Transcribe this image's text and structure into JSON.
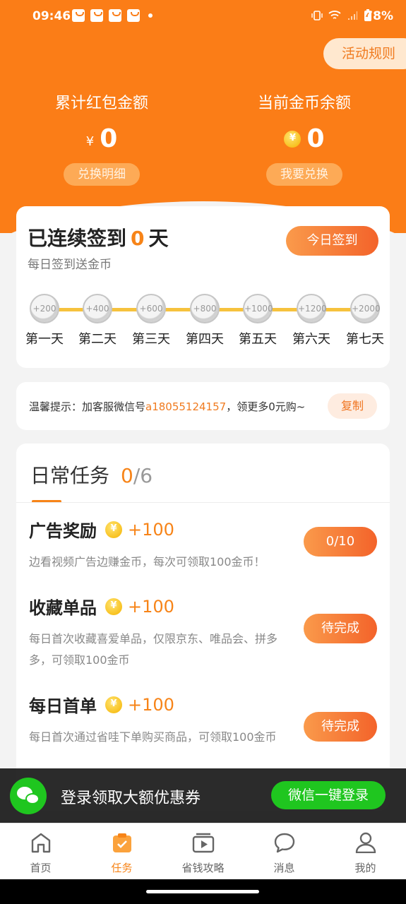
{
  "status_bar": {
    "time": "09:46",
    "battery": "78%"
  },
  "header": {
    "rules_button": "活动规则",
    "redpacket": {
      "label": "累计红包金额",
      "currency": "¥",
      "value": "0",
      "button": "兑换明细"
    },
    "coins": {
      "label": "当前金币余额",
      "value": "0",
      "button": "我要兑换"
    }
  },
  "checkin": {
    "title_prefix": "已连续签到",
    "days_count": "0",
    "title_suffix": "天",
    "subtitle": "每日签到送金币",
    "sign_button": "今日签到",
    "days": [
      {
        "reward": "+200",
        "label": "第一天"
      },
      {
        "reward": "+400",
        "label": "第二天"
      },
      {
        "reward": "+600",
        "label": "第三天"
      },
      {
        "reward": "+800",
        "label": "第四天"
      },
      {
        "reward": "+1000",
        "label": "第五天"
      },
      {
        "reward": "+1200",
        "label": "第六天"
      },
      {
        "reward": "+2000",
        "label": "第七天"
      }
    ]
  },
  "tip": {
    "prefix": "温馨提示：加客服微信号",
    "wechat_id": "a18055124157",
    "suffix": "，领更多0元购~",
    "copy_button": "复制"
  },
  "tasks": {
    "title": "日常任务",
    "done": "0",
    "total": "/6",
    "items": [
      {
        "name": "广告奖励",
        "reward": "+100",
        "desc": "边看视频广告边赚金币，每次可领取100金币！",
        "button": "0/10"
      },
      {
        "name": "收藏单品",
        "reward": "+100",
        "desc": "每日首次收藏喜爱单品，仅限京东、唯品会、拼多多，可领取100金币",
        "button": "待完成"
      },
      {
        "name": "每日首单",
        "reward": "+100",
        "desc": "每日首次通过省哇下单购买商品，可领取100金币",
        "button": "待完成"
      }
    ]
  },
  "login_banner": {
    "text": "登录领取大额优惠券",
    "button": "微信一键登录"
  },
  "tabbar": {
    "items": [
      {
        "label": "首页",
        "icon": "home-icon"
      },
      {
        "label": "任务",
        "icon": "task-icon"
      },
      {
        "label": "省钱攻略",
        "icon": "video-icon"
      },
      {
        "label": "消息",
        "icon": "message-icon"
      },
      {
        "label": "我的",
        "icon": "profile-icon"
      }
    ],
    "active_index": 1
  },
  "colors": {
    "brand_orange": "#fb7d17",
    "accent": "#f78418",
    "wechat_green": "#1fc61f"
  }
}
